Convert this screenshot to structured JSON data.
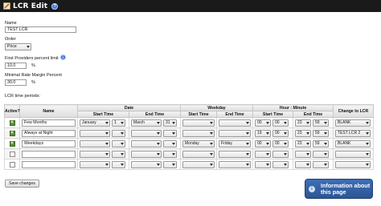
{
  "window": {
    "title": "LCR Edit"
  },
  "form": {
    "name_label": "Name",
    "name_value": "TEST LCR",
    "order_label": "Order",
    "order_value": "Price",
    "first_providers_label": "First Providers percent limit",
    "first_providers_value": "10.0",
    "first_providers_unit": "%",
    "min_margin_label": "Minimal Rate Margin Percent",
    "min_margin_value": "30.0",
    "min_margin_unit": "%",
    "periods_label": "LCR time periods:"
  },
  "table": {
    "group_headers": {
      "date": "Date",
      "weekday": "Weekday",
      "hour_minute": "Hour : Minute"
    },
    "headers": {
      "active": "Active?",
      "name": "Name",
      "start_time": "Start Time",
      "end_time": "End Time",
      "change_to_lcr": "Change to LCR"
    },
    "rows": [
      {
        "active": true,
        "name": "Few Months",
        "date_start_month": "January",
        "date_start_day": "1",
        "date_end_month": "March",
        "date_end_day": "31",
        "weekday_start": "",
        "weekday_end": "",
        "start_hour": "00",
        "start_min": "00",
        "end_hour": "23",
        "end_min": "59",
        "lcr": "BLANK"
      },
      {
        "active": true,
        "name": "Always at Night",
        "date_start_month": "",
        "date_start_day": "",
        "date_end_month": "",
        "date_end_day": "",
        "weekday_start": "",
        "weekday_end": "",
        "start_hour": "19",
        "start_min": "00",
        "end_hour": "23",
        "end_min": "59",
        "lcr": "TEST LCR 2"
      },
      {
        "active": true,
        "name": "Weekdays",
        "date_start_month": "",
        "date_start_day": "",
        "date_end_month": "",
        "date_end_day": "",
        "weekday_start": "Monday",
        "weekday_end": "Friday",
        "start_hour": "00",
        "start_min": "00",
        "end_hour": "23",
        "end_min": "59",
        "lcr": "BLANK"
      },
      {
        "active": false,
        "name": "",
        "date_start_month": "",
        "date_start_day": "",
        "date_end_month": "",
        "date_end_day": "",
        "weekday_start": "",
        "weekday_end": "",
        "start_hour": "",
        "start_min": "",
        "end_hour": "",
        "end_min": "",
        "lcr": ""
      },
      {
        "active": false,
        "name": "",
        "date_start_month": "",
        "date_start_day": "",
        "date_end_month": "",
        "date_end_day": "",
        "weekday_start": "",
        "weekday_end": "",
        "start_hour": "",
        "start_min": "",
        "end_hour": "",
        "end_min": "",
        "lcr": ""
      }
    ]
  },
  "buttons": {
    "save": "Save changes"
  },
  "info_box": {
    "text": "Information about this page"
  },
  "icons": {
    "title_icon": "edit-pencil-icon",
    "help_icon": "help-icon",
    "info_icon": "info-icon"
  },
  "colors": {
    "titlebar": "#1a1a1a",
    "active_check": "#5e8e3a",
    "info_box": "#2c5593"
  }
}
